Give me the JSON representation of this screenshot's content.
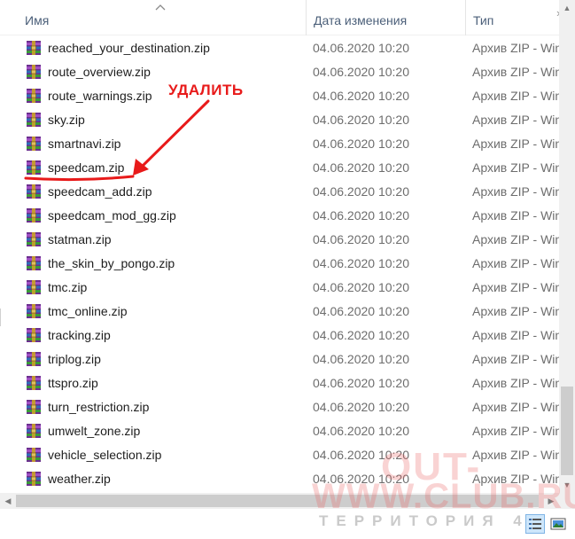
{
  "columns": {
    "name": "Имя",
    "date": "Дата изменения",
    "type": "Тип"
  },
  "files": [
    {
      "name": "reached_your_destination.zip",
      "date": "04.06.2020 10:20",
      "type": "Архив ZIP - WinRAR"
    },
    {
      "name": "route_overview.zip",
      "date": "04.06.2020 10:20",
      "type": "Архив ZIP - WinRAR"
    },
    {
      "name": "route_warnings.zip",
      "date": "04.06.2020 10:20",
      "type": "Архив ZIP - WinRAR"
    },
    {
      "name": "sky.zip",
      "date": "04.06.2020 10:20",
      "type": "Архив ZIP - WinRAR"
    },
    {
      "name": "smartnavi.zip",
      "date": "04.06.2020 10:20",
      "type": "Архив ZIP - WinRAR"
    },
    {
      "name": "speedcam.zip",
      "date": "04.06.2020 10:20",
      "type": "Архив ZIP - WinRAR"
    },
    {
      "name": "speedcam_add.zip",
      "date": "04.06.2020 10:20",
      "type": "Архив ZIP - WinRAR"
    },
    {
      "name": "speedcam_mod_gg.zip",
      "date": "04.06.2020 10:20",
      "type": "Архив ZIP - WinRAR"
    },
    {
      "name": "statman.zip",
      "date": "04.06.2020 10:20",
      "type": "Архив ZIP - WinRAR"
    },
    {
      "name": "the_skin_by_pongo.zip",
      "date": "04.06.2020 10:20",
      "type": "Архив ZIP - WinRAR"
    },
    {
      "name": "tmc.zip",
      "date": "04.06.2020 10:20",
      "type": "Архив ZIP - WinRAR"
    },
    {
      "name": "tmc_online.zip",
      "date": "04.06.2020 10:20",
      "type": "Архив ZIP - WinRAR"
    },
    {
      "name": "tracking.zip",
      "date": "04.06.2020 10:20",
      "type": "Архив ZIP - WinRAR"
    },
    {
      "name": "triplog.zip",
      "date": "04.06.2020 10:20",
      "type": "Архив ZIP - WinRAR"
    },
    {
      "name": "ttspro.zip",
      "date": "04.06.2020 10:20",
      "type": "Архив ZIP - WinRAR"
    },
    {
      "name": "turn_restriction.zip",
      "date": "04.06.2020 10:20",
      "type": "Архив ZIP - WinRAR"
    },
    {
      "name": "umwelt_zone.zip",
      "date": "04.06.2020 10:20",
      "type": "Архив ZIP - WinRAR"
    },
    {
      "name": "vehicle_selection.zip",
      "date": "04.06.2020 10:20",
      "type": "Архив ZIP - WinRAR"
    },
    {
      "name": "weather.zip",
      "date": "04.06.2020 10:20",
      "type": "Архив ZIP - WinRAR"
    }
  ],
  "annotation": {
    "text": "УДАЛИТЬ",
    "target": "speedcam.zip",
    "color": "#e81a1a"
  },
  "watermark": {
    "line1": "OUT-",
    "line2": "WWW.CLUB.RU",
    "line3": "ТЕРРИТОРИЯ 4"
  },
  "icons": {
    "file": "winrar-archive-icon",
    "sort": "sort-ascending-icon",
    "details_view": "details-view-icon",
    "tiles_view": "large-icons-view-icon"
  },
  "colors": {
    "header_text": "#4c607a",
    "muted_text": "#6d6d6d",
    "accent": "#e81a1a",
    "selected_view": "#cde6fb"
  }
}
